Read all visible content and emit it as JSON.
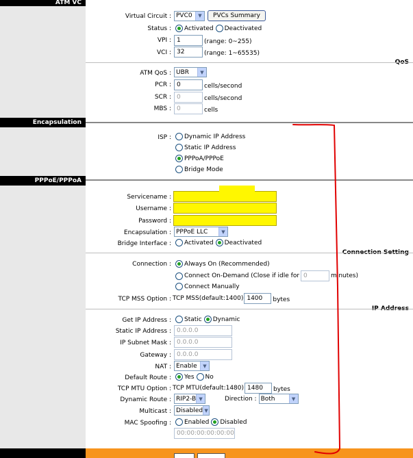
{
  "sections": {
    "atm_vc": "ATM VC",
    "qos": "QoS",
    "encapsulation": "Encapsulation",
    "pppoe": "PPPoE/PPPoA",
    "connection_setting": "Connection Setting",
    "ip_address": "IP Address"
  },
  "atm": {
    "virtual_circuit_label": "Virtual Circuit :",
    "virtual_circuit_value": "PVC0",
    "pvcs_summary": "PVCs Summary",
    "status_label": "Status :",
    "status_activated": "Activated",
    "status_deactivated": "Deactivated",
    "vpi_label": "VPI :",
    "vpi_value": "1",
    "vpi_range": "(range: 0~255)",
    "vci_label": "VCI :",
    "vci_value": "32",
    "vci_range": "(range: 1~65535)"
  },
  "qos": {
    "atm_qos_label": "ATM QoS :",
    "atm_qos_value": "UBR",
    "pcr_label": "PCR :",
    "pcr_value": "0",
    "scr_label": "SCR :",
    "scr_value": "0",
    "mbs_label": "MBS :",
    "mbs_value": "0",
    "cells_per_second": "cells/second",
    "cells_per_second_2": "cells/second",
    "cells": "cells"
  },
  "isp": {
    "label": "ISP :",
    "options": [
      "Dynamic IP Address",
      "Static IP Address",
      "PPPoA/PPPoE",
      "Bridge Mode"
    ],
    "selected_index": 2
  },
  "pppoe": {
    "servicename_label": "Servicename :",
    "username_label": "Username :",
    "password_label": "Password :",
    "encapsulation_label": "Encapsulation :",
    "encapsulation_value": "PPPoE LLC",
    "bridge_interface_label": "Bridge Interface :",
    "bridge_activated": "Activated",
    "bridge_deactivated": "Deactivated"
  },
  "connection": {
    "label": "Connection :",
    "always_on": "Always On (Recommended)",
    "on_demand": "Connect On-Demand (Close if idle for",
    "on_demand_value": "0",
    "minutes": "minutes)",
    "manually": "Connect Manually",
    "tcp_mss_label": "TCP MSS Option :",
    "tcp_mss_text": "TCP MSS(default:1400)",
    "tcp_mss_value": "1400",
    "bytes": "bytes"
  },
  "ip": {
    "get_ip_label": "Get IP Address :",
    "static": "Static",
    "dynamic": "Dynamic",
    "static_ip_label": "Static IP Address :",
    "static_ip_value": "0.0.0.0",
    "subnet_label": "IP Subnet Mask :",
    "subnet_value": "0.0.0.0",
    "gateway_label": "Gateway :",
    "gateway_value": "0.0.0.0",
    "nat_label": "NAT :",
    "nat_value": "Enable",
    "default_route_label": "Default Route :",
    "yes": "Yes",
    "no": "No",
    "tcp_mtu_label": "TCP MTU Option :",
    "tcp_mtu_text": "TCP MTU(default:1480)",
    "tcp_mtu_value": "1480",
    "bytes": "bytes",
    "dynamic_route_label": "Dynamic Route :",
    "dynamic_route_value": "RIP2-B",
    "direction_label": "Direction :",
    "direction_value": "Both",
    "multicast_label": "Multicast :",
    "multicast_value": "Disabled",
    "mac_spoofing_label": "MAC Spoofing :",
    "mac_enabled": "Enabled",
    "mac_disabled": "Disabled",
    "mac_value": "00:00:00:00:00:00"
  },
  "colors": {
    "highlight": "#fff700",
    "annotation": "#e00000",
    "footer_bar": "#f7941d",
    "radio_dot": "#21a121"
  }
}
